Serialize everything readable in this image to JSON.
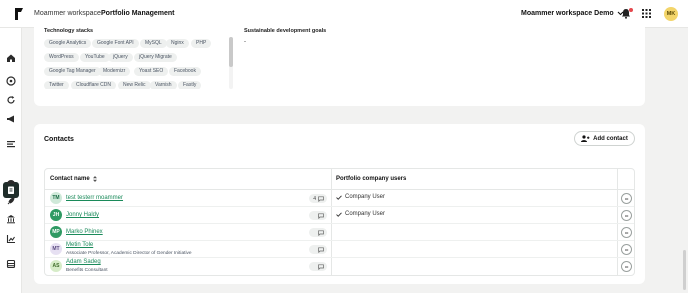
{
  "header": {
    "workspace": "Moammer workspace",
    "page_title": "Portfolio Management",
    "workspace_switcher": "Moammer workspace Demo",
    "user_initials": "MK"
  },
  "colors": {
    "accent_green": "#1a8a5a",
    "sidebar_active": "#1f2d2a",
    "notification_dot": "#e5484d",
    "user_avatar": "#f3d56a"
  },
  "sidebar": {
    "icons": [
      "home-icon",
      "compass-icon",
      "refresh-icon",
      "megaphone-icon",
      "list-icon",
      "clipboard-icon",
      "gauge-icon",
      "rocket-icon",
      "bank-icon",
      "chart-icon",
      "database-icon"
    ]
  },
  "profile": {
    "tech_title": "Technology stacks",
    "tech_chips": [
      "Google Analytics",
      "Google Font API",
      "MySQL",
      "Nginx",
      "PHP",
      "WordPress",
      "YouTube",
      "jQuery",
      "jQuery Migrate",
      "Google Tag Manager",
      "Modernizr",
      "Yoast SEO",
      "Facebook",
      "Twitter",
      "Cloudflare CDN",
      "New Relic",
      "Varnish",
      "Fastly"
    ],
    "sdg_title": "Sustainable development goals",
    "sdg_value": "-"
  },
  "contacts": {
    "title": "Contacts",
    "add_button": "Add contact",
    "col_name": "Contact name",
    "col_users": "Portfolio company users",
    "rows": [
      {
        "initials": "TM",
        "name": "test testerr moammer",
        "subtitle": "",
        "comments": "4",
        "user": "Company User",
        "avatar_bg": "#cfe9d9",
        "avatar_fg": "#1a6b45"
      },
      {
        "initials": "JH",
        "name": "Jonny Haldy",
        "subtitle": "",
        "comments": "",
        "user": "Company User",
        "avatar_bg": "#2f9a63",
        "avatar_fg": "#ffffff"
      },
      {
        "initials": "MP",
        "name": "Marko Phinex",
        "subtitle": "",
        "comments": "",
        "user": "",
        "avatar_bg": "#2f9a63",
        "avatar_fg": "#ffffff"
      },
      {
        "initials": "MT",
        "name": "Metin Tole",
        "subtitle": "Associate Professor, Academic Director of Gender Initiative",
        "comments": "",
        "user": "",
        "avatar_bg": "#e6e0f2",
        "avatar_fg": "#5a4a80"
      },
      {
        "initials": "AS",
        "name": "Adam Sadeg",
        "subtitle": "Benefits Consultant",
        "comments": "",
        "user": "",
        "avatar_bg": "#d6ecc8",
        "avatar_fg": "#3f6b2a"
      }
    ]
  }
}
